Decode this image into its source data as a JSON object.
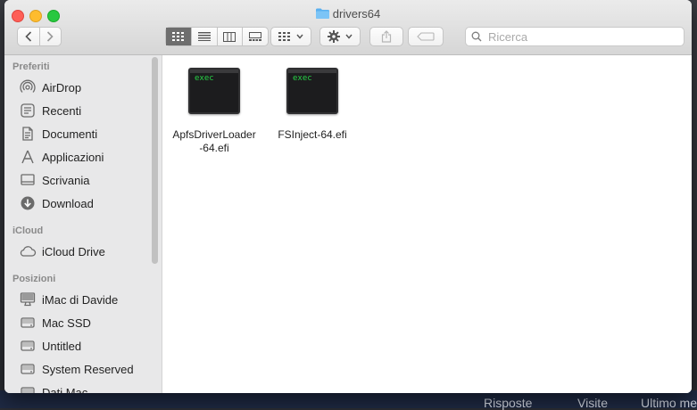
{
  "window": {
    "title": "drivers64"
  },
  "toolbar": {
    "back_icon": "chevron-left-icon",
    "forward_icon": "chevron-right-icon",
    "views": [
      "icon-view",
      "list-view",
      "column-view",
      "gallery-view"
    ],
    "active_view": "icon-view",
    "search_placeholder": "Ricerca"
  },
  "sidebar": {
    "sections": [
      {
        "title": "Preferiti",
        "items": [
          {
            "label": "AirDrop",
            "icon": "airdrop-icon"
          },
          {
            "label": "Recenti",
            "icon": "clock-icon"
          },
          {
            "label": "Documenti",
            "icon": "document-icon"
          },
          {
            "label": "Applicazioni",
            "icon": "applications-icon"
          },
          {
            "label": "Scrivania",
            "icon": "desktop-icon"
          },
          {
            "label": "Download",
            "icon": "download-icon"
          }
        ]
      },
      {
        "title": "iCloud",
        "items": [
          {
            "label": "iCloud Drive",
            "icon": "cloud-icon"
          }
        ]
      },
      {
        "title": "Posizioni",
        "items": [
          {
            "label": "iMac di Davide",
            "icon": "imac-icon"
          },
          {
            "label": "Mac SSD",
            "icon": "disk-icon"
          },
          {
            "label": "Untitled",
            "icon": "disk-icon"
          },
          {
            "label": "System Reserved",
            "icon": "disk-icon"
          },
          {
            "label": "Dati Mac",
            "icon": "disk-icon"
          }
        ]
      }
    ]
  },
  "files": [
    {
      "name": "ApfsDriverLoader\n-64.efi",
      "name_line1": "ApfsDriverLoader",
      "name_line2": "-64.efi",
      "icon_text": "exec"
    },
    {
      "name_line1": "FSInject-64.efi",
      "icon_text": "exec"
    }
  ],
  "background": {
    "links": [
      "Risposte",
      "Visite",
      "Ultimo me"
    ]
  },
  "colors": {
    "close": "#fe5f57",
    "minimize": "#febc2e",
    "zoom": "#28c840",
    "folder": "#5ab0f0",
    "exec_text": "#27d045"
  }
}
